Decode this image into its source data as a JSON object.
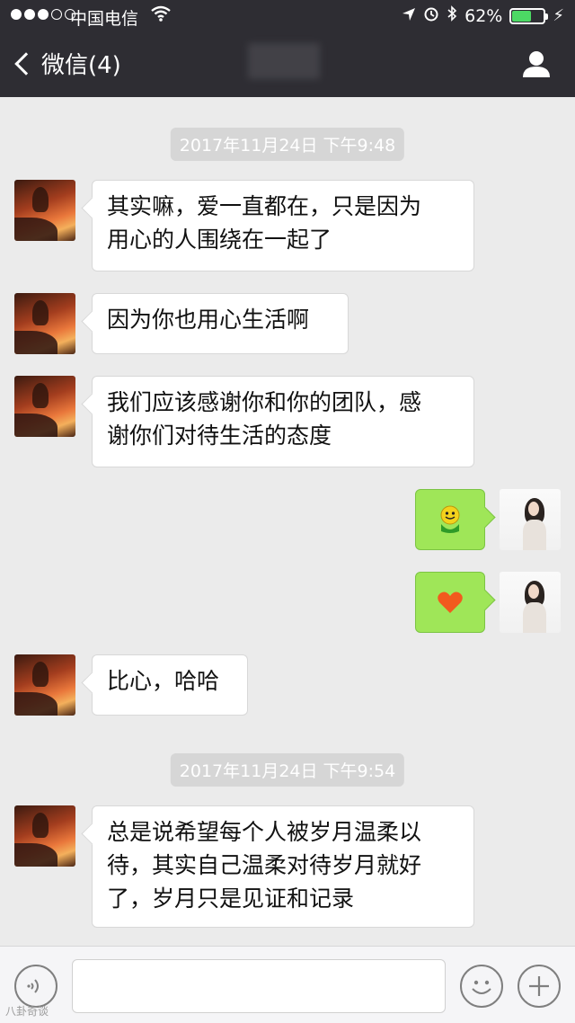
{
  "status_bar": {
    "carrier": "中国电信",
    "battery_percent": "62%",
    "battery_level": 0.62
  },
  "nav": {
    "back_label": "微信(4)"
  },
  "chat": {
    "timestamps": [
      "2017年11月24日 下午9:48",
      "2017年11月24日 下午9:54"
    ],
    "messages": [
      {
        "side": "left",
        "text": "其实嘛，爱一直都在，只是因为\n用心的人围绕在一起了"
      },
      {
        "side": "left",
        "text": "因为你也用心生活啊"
      },
      {
        "side": "left",
        "text": "我们应该感谢你和你的团队，感\n谢你们对待生活的态度"
      },
      {
        "side": "right",
        "emoji": "green-smiley-emoji"
      },
      {
        "side": "right",
        "emoji": "heart-emoji"
      },
      {
        "side": "left",
        "text": "比心，哈哈"
      },
      {
        "side": "left",
        "text": "总是说希望每个人被岁月温柔以\n待，其实自己温柔对待岁月就好\n了，岁月只是见证和记录"
      }
    ]
  },
  "input_bar": {
    "text": "",
    "watermark": "八卦奇谈"
  },
  "colors": {
    "header_bg": "#2e2d33",
    "chat_bg": "#ebebeb",
    "own_bubble": "#9fe658",
    "battery": "#4cd964"
  }
}
